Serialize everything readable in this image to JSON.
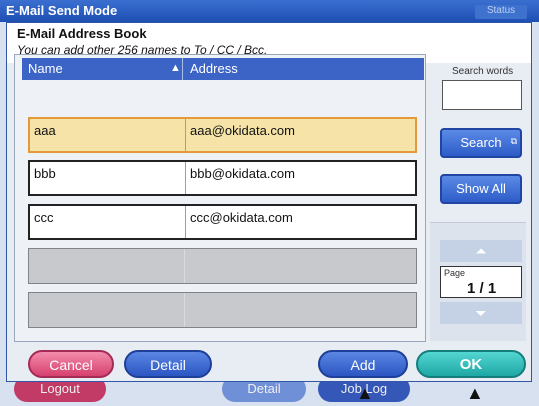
{
  "window": {
    "title": "E-Mail Send Mode",
    "status_label": "Status",
    "bg_buttons": {
      "logout": "Logout",
      "detail": "Detail",
      "job_log": "Job Log"
    }
  },
  "dialog": {
    "title": "E-Mail Address Book",
    "subtitle": "You can add other 256 names to To / CC / Bcc."
  },
  "table": {
    "columns": {
      "name": "Name",
      "address": "Address"
    },
    "sort_indicator": "▲",
    "rows": [
      {
        "name": "aaa",
        "address": "aaa@okidata.com",
        "selected": true
      },
      {
        "name": "bbb",
        "address": "bbb@okidata.com",
        "selected": false
      },
      {
        "name": "ccc",
        "address": "ccc@okidata.com",
        "selected": false
      }
    ]
  },
  "search": {
    "label": "Search words",
    "value": "",
    "search_button": "Search",
    "show_all_button": "Show All"
  },
  "pager": {
    "label": "Page",
    "value": "1 / 1"
  },
  "footer": {
    "cancel": "Cancel",
    "detail": "Detail",
    "add": "Add",
    "ok": "OK"
  },
  "colors": {
    "selected_row": "#f6e3a8",
    "header_blue": "#3c64c7",
    "ok_teal": "#1ea7a4",
    "cancel_pink": "#d6406f"
  }
}
